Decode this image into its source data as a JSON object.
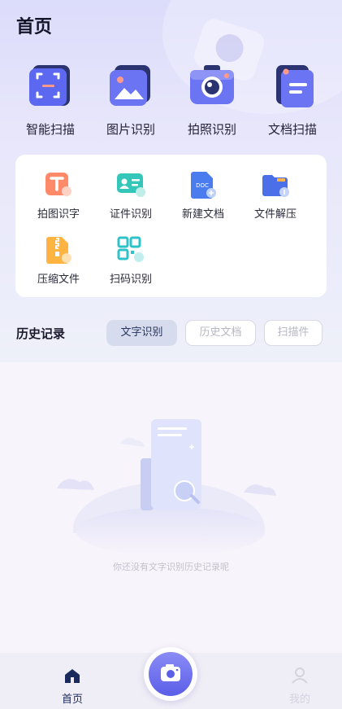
{
  "header": {
    "title": "首页"
  },
  "main_tools": [
    {
      "label": "智能扫描",
      "icon": "smart-scan-icon"
    },
    {
      "label": "图片识别",
      "icon": "image-recognition-icon"
    },
    {
      "label": "拍照识别",
      "icon": "camera-recognition-icon"
    },
    {
      "label": "文档扫描",
      "icon": "document-scan-icon"
    }
  ],
  "sub_tools": [
    {
      "label": "拍图识字",
      "icon": "photo-text-icon"
    },
    {
      "label": "证件识别",
      "icon": "id-card-icon"
    },
    {
      "label": "新建文档",
      "icon": "new-doc-icon"
    },
    {
      "label": "文件解压",
      "icon": "unzip-folder-icon"
    },
    {
      "label": "压缩文件",
      "icon": "zip-file-icon"
    },
    {
      "label": "扫码识别",
      "icon": "qr-code-icon"
    }
  ],
  "history": {
    "title": "历史记录",
    "tabs": [
      {
        "label": "文字识别",
        "active": true
      },
      {
        "label": "历史文档",
        "active": false
      },
      {
        "label": "扫描件",
        "active": false
      }
    ],
    "empty_text": "你还没有文字识别历史记录呢"
  },
  "doc_icon_text": "DOC",
  "bottom_nav": {
    "home": {
      "label": "首页",
      "icon": "home-icon"
    },
    "camera": {
      "icon": "camera-icon"
    },
    "mine": {
      "label": "我的",
      "icon": "user-icon"
    }
  },
  "colors": {
    "accent": "#5b5ee8",
    "nav_active": "#1b2a5c",
    "nav_inactive": "#d3d3df"
  }
}
